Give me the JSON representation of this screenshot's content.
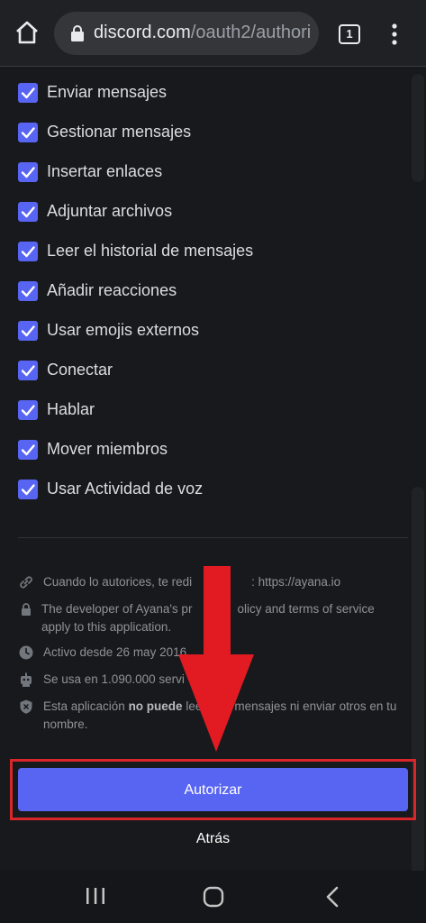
{
  "browser": {
    "url_domain": "discord.com",
    "url_path": "/oauth2/authori",
    "tab_count": "1"
  },
  "permissions": [
    {
      "label": "Enviar mensajes",
      "checked": true
    },
    {
      "label": "Gestionar mensajes",
      "checked": true
    },
    {
      "label": "Insertar enlaces",
      "checked": true
    },
    {
      "label": "Adjuntar archivos",
      "checked": true
    },
    {
      "label": "Leer el historial de mensajes",
      "checked": true
    },
    {
      "label": "Añadir reacciones",
      "checked": true
    },
    {
      "label": "Usar emojis externos",
      "checked": true
    },
    {
      "label": "Conectar",
      "checked": true
    },
    {
      "label": "Hablar",
      "checked": true
    },
    {
      "label": "Mover miembros",
      "checked": true
    },
    {
      "label": "Usar Actividad de voz",
      "checked": true
    }
  ],
  "info": {
    "redirect": "Cuando lo autorices, te redi",
    "redirect_end": ": https://ayana.io",
    "privacy": "The developer of Ayana's pr",
    "privacy_end": "olicy and terms of service apply to this application.",
    "active": "Activo desde 26 may 2016",
    "servers": "Se usa en 1.090.000 servi",
    "cannot_prefix": "Esta aplicación ",
    "cannot_bold": "no puede",
    "cannot_suffix": " lee",
    "cannot_end": "mensajes ni enviar otros en tu nombre."
  },
  "actions": {
    "authorize": "Autorizar",
    "back": "Atrás"
  },
  "colors": {
    "accent": "#5865f2",
    "highlight_red": "#e21b23",
    "background": "#18191c"
  }
}
